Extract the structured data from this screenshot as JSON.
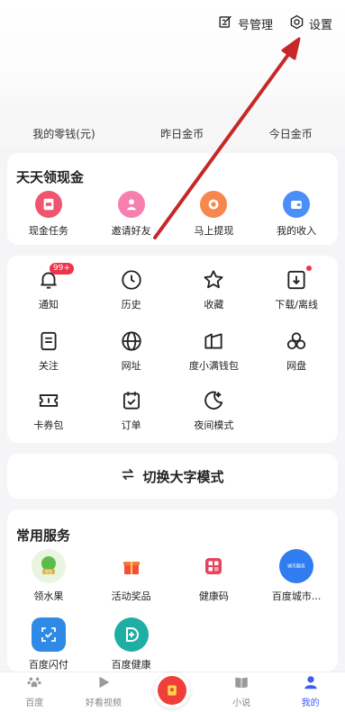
{
  "header": {
    "account_manage": "号管理",
    "settings": "设置"
  },
  "wallet": {
    "items": [
      "我的零钱(元)",
      "昨日金币",
      "今日金币"
    ]
  },
  "cash": {
    "title": "天天领现金",
    "items": [
      {
        "label": "现金任务",
        "icon": "cash-task-icon",
        "color": "#f0546e"
      },
      {
        "label": "邀请好友",
        "icon": "invite-friend-icon",
        "color": "#f77fb0"
      },
      {
        "label": "马上提现",
        "icon": "withdraw-icon",
        "color": "#f7874d"
      },
      {
        "label": "我的收入",
        "icon": "income-icon",
        "color": "#4b8ef7"
      }
    ]
  },
  "tools": {
    "rows": [
      [
        {
          "label": "通知",
          "icon": "bell-icon",
          "badge": "99+"
        },
        {
          "label": "历史",
          "icon": "clock-icon"
        },
        {
          "label": "收藏",
          "icon": "star-icon"
        },
        {
          "label": "下载/离线",
          "icon": "download-icon",
          "dot": true
        }
      ],
      [
        {
          "label": "关注",
          "icon": "follow-icon"
        },
        {
          "label": "网址",
          "icon": "globe-icon"
        },
        {
          "label": "度小满钱包",
          "icon": "wallet-icon"
        },
        {
          "label": "网盘",
          "icon": "cloud-drive-icon"
        }
      ],
      [
        {
          "label": "卡券包",
          "icon": "ticket-icon"
        },
        {
          "label": "订单",
          "icon": "order-icon"
        },
        {
          "label": "夜间模式",
          "icon": "moon-icon"
        }
      ]
    ]
  },
  "bigfont": {
    "label": "切换大字模式"
  },
  "services": {
    "title": "常用服务",
    "rows": [
      [
        {
          "label": "领水果",
          "icon": "fruit-tree-icon",
          "color": "#4caf50",
          "inner": "0元"
        },
        {
          "label": "活动奖品",
          "icon": "gift-icon",
          "color": "#ffffff"
        },
        {
          "label": "健康码",
          "icon": "health-code-icon",
          "color": "#e8435b"
        },
        {
          "label": "百度城市...",
          "icon": "city-service-icon",
          "color": "#2f7df0",
          "inner": "城市服务"
        }
      ],
      [
        {
          "label": "百度闪付",
          "icon": "flash-pay-icon",
          "color": "#2f8ae5"
        },
        {
          "label": "百度健康",
          "icon": "health-plus-icon",
          "color": "#1faea3"
        }
      ]
    ]
  },
  "tabbar": {
    "tabs": [
      {
        "label": "百度",
        "icon": "baidu-paw-icon"
      },
      {
        "label": "好看视频",
        "icon": "video-play-icon"
      },
      {
        "label": "",
        "icon": "red-packet-icon"
      },
      {
        "label": "小说",
        "icon": "book-icon"
      },
      {
        "label": "我的",
        "icon": "profile-icon",
        "active": true
      }
    ]
  },
  "colors": {
    "accent": "#3f5bf5",
    "badge": "#f0334c",
    "annotation_arrow": "#c62828"
  }
}
